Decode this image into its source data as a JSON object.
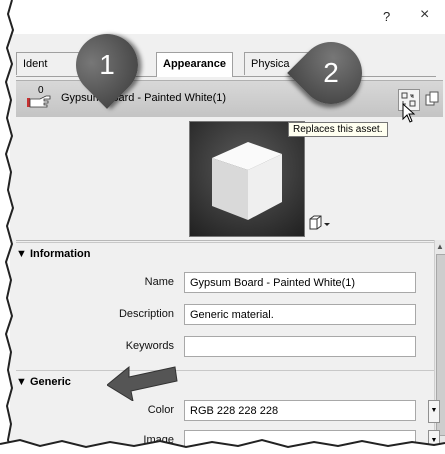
{
  "window": {
    "help_label": "?",
    "close_label": "×"
  },
  "tabs": [
    {
      "label": "Ident"
    },
    {
      "label": "Appearance"
    },
    {
      "label": "Physica"
    }
  ],
  "asset": {
    "count": "0",
    "name": "Gypsum Board - Painted White(1)"
  },
  "tooltip": {
    "text": "Replaces this asset."
  },
  "sections": {
    "information": "▼ Information",
    "generic": "▼ Generic"
  },
  "information": {
    "name_label": "Name",
    "name_value": "Gypsum Board - Painted White(1)",
    "description_label": "Description",
    "description_value": "Generic material.",
    "keywords_label": "Keywords",
    "keywords_value": ""
  },
  "generic": {
    "color_label": "Color",
    "color_value": "RGB 228 228 228",
    "image_label": "Image"
  },
  "callouts": {
    "one": "1",
    "two": "2"
  },
  "colors": {
    "callout": "#4a4a4a",
    "asset_bar": "#cccccc",
    "window_bg": "#f0f0f0"
  }
}
